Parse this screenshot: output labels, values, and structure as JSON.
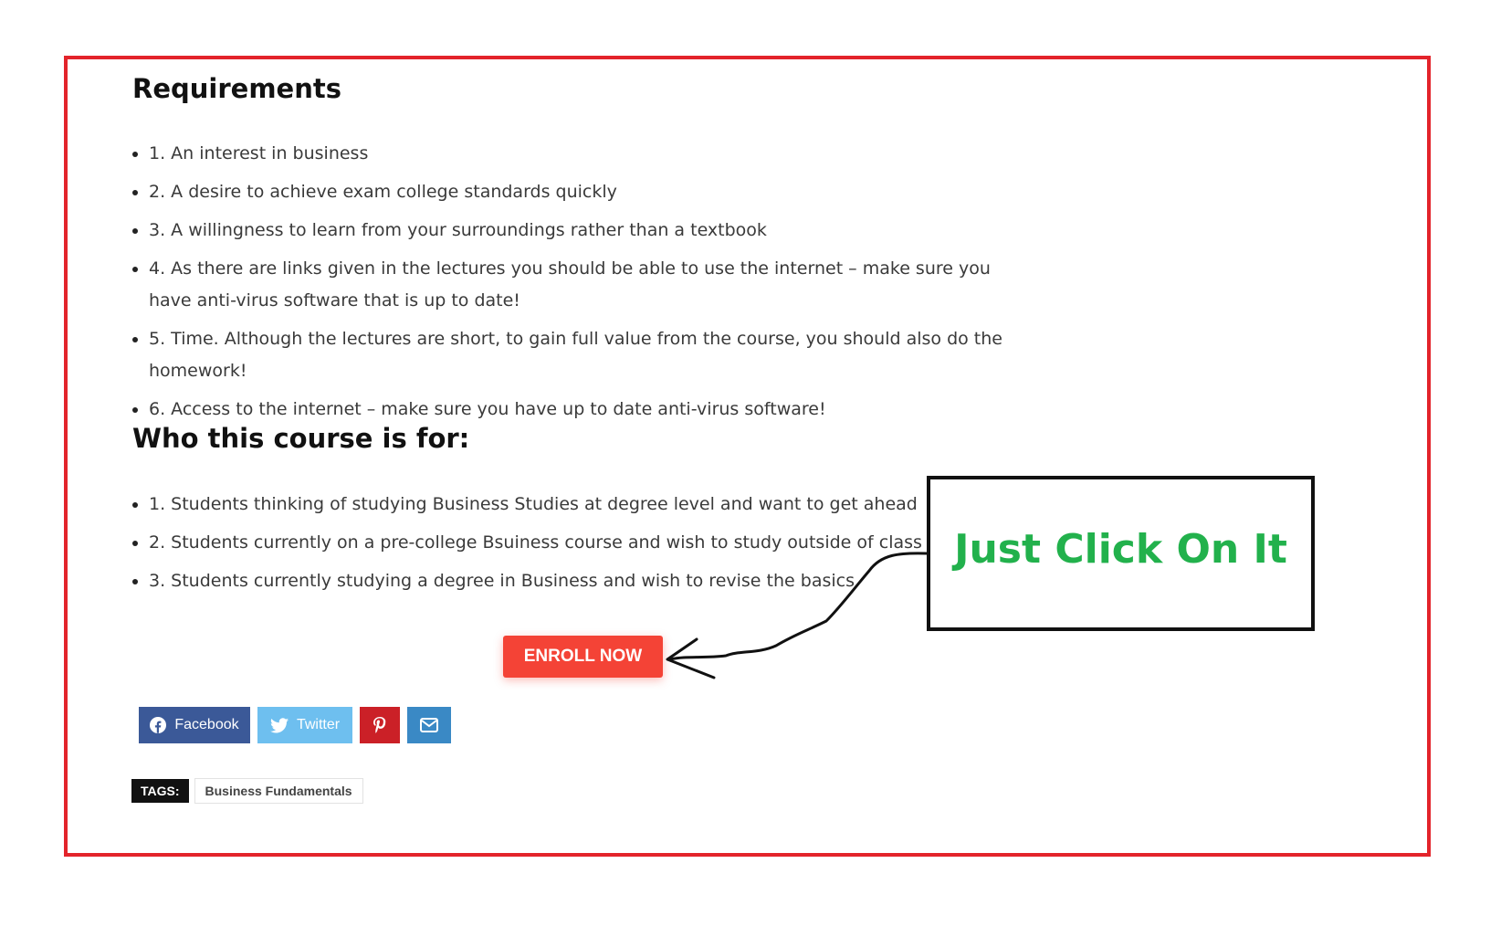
{
  "requirements": {
    "title": "Requirements",
    "items": [
      "1. An interest in business",
      "2. A desire to achieve exam college standards quickly",
      "3. A willingness to learn from your surroundings rather than a textbook",
      "4. As there are links given in the lectures you should be able to use the internet – make sure you have anti-virus software that is up to date!",
      "5. Time. Although the lectures are short, to gain full value from the course, you should also do the homework!",
      "6. Access to the internet – make sure you have up to date anti-virus software!"
    ]
  },
  "audience": {
    "title": "Who this course is for:",
    "items": [
      "1. Students thinking of studying Business Studies at degree level and want to get ahead",
      "2. Students currently on a pre-college Bsuiness course and wish to study outside of class",
      "3. Students currently studying a degree in Business and wish to revise the basics"
    ]
  },
  "enroll": {
    "label": "ENROLL NOW"
  },
  "callout": {
    "text": "Just Click On It"
  },
  "share": {
    "facebook": {
      "label": "Facebook",
      "icon": "facebook-icon"
    },
    "twitter": {
      "label": "Twitter",
      "icon": "twitter-icon"
    },
    "pinterest": {
      "icon": "pinterest-icon"
    },
    "email": {
      "icon": "envelope-icon"
    }
  },
  "tags": {
    "label": "TAGS:",
    "items": [
      "Business Fundamentals"
    ]
  },
  "colors": {
    "frame": "#e3242b",
    "enroll": "#f44336",
    "callout_text": "#22b14c",
    "facebook": "#3b5998",
    "twitter": "#6ebfef",
    "pinterest": "#cb2027",
    "email": "#3a89c5"
  }
}
